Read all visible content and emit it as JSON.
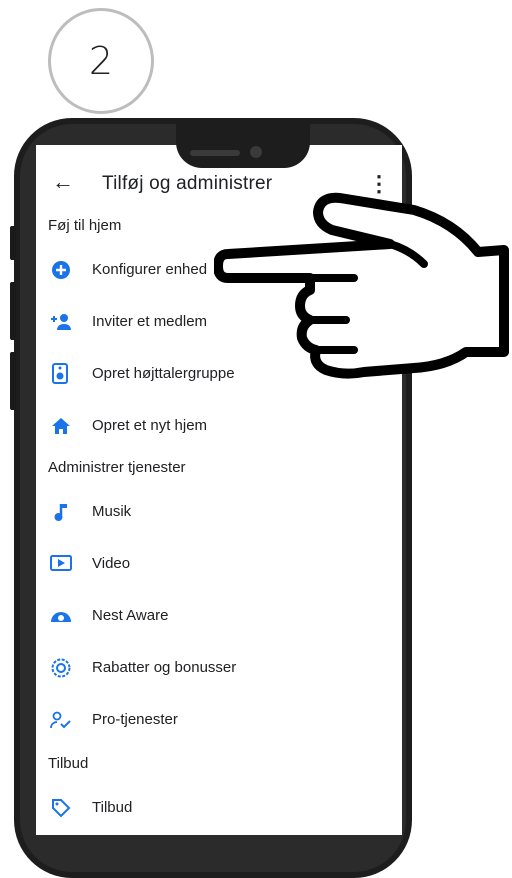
{
  "step": {
    "number": "2"
  },
  "appbar": {
    "title": "Tilføj og administrer",
    "back_icon": "arrow-back-icon",
    "menu_icon": "more-vert-icon"
  },
  "sections": {
    "add_home": "Føj til hjem",
    "manage_services": "Administrer tjenester",
    "offers": "Tilbud"
  },
  "items": {
    "configure": "Konfigurer enhed",
    "invite": "Inviter et medlem",
    "speaker_group": "Opret højttalergruppe",
    "new_home": "Opret et nyt hjem",
    "music": "Musik",
    "video": "Video",
    "nest_aware": "Nest Aware",
    "discounts": "Rabatter og bonusser",
    "pro_services": "Pro-tjenester",
    "offers": "Tilbud"
  },
  "colors": {
    "accent": "#1a73e8",
    "text": "#202124",
    "phone": "#1d1d1d"
  }
}
